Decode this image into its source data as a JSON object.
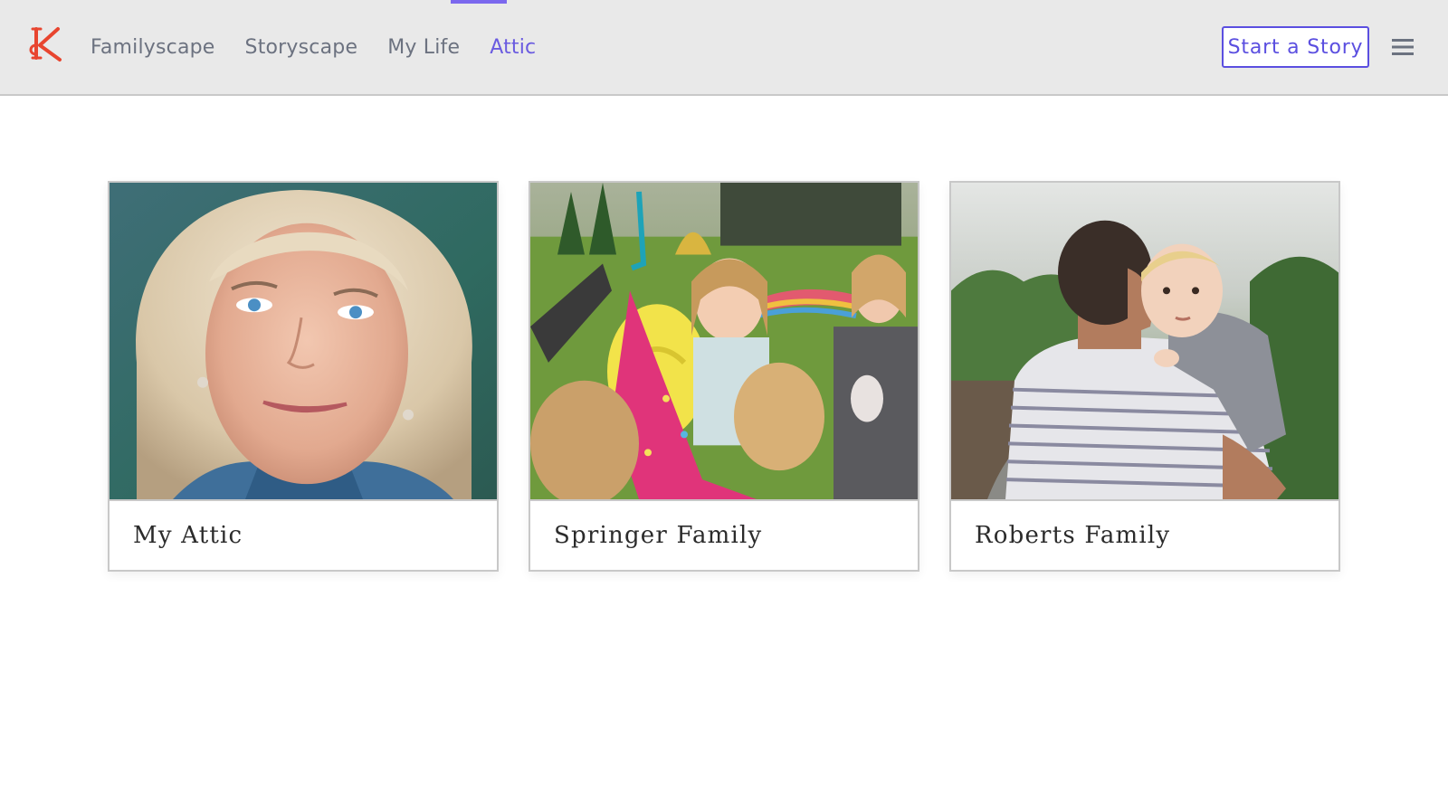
{
  "header": {
    "logo_icon": "monogram-k-logo",
    "accent_color": "#6a5be0",
    "nav": [
      {
        "label": "Familyscape",
        "active": false
      },
      {
        "label": "Storyscape",
        "active": false
      },
      {
        "label": "My Life",
        "active": false
      },
      {
        "label": "Attic",
        "active": true
      }
    ],
    "cta_label": "Start a Story",
    "menu_icon": "hamburger-menu-icon"
  },
  "cards": [
    {
      "label": "My Attic",
      "image": "portrait-blonde-woman-photo"
    },
    {
      "label": "Springer Family",
      "image": "children-party-pinata-photo"
    },
    {
      "label": "Roberts Family",
      "image": "father-carrying-child-photo"
    }
  ]
}
